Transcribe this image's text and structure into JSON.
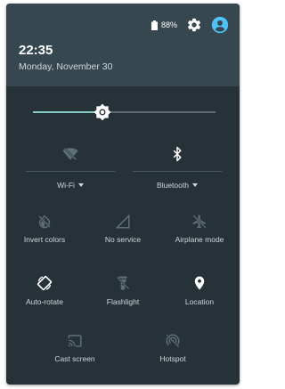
{
  "status": {
    "battery_text": "88%"
  },
  "header": {
    "time": "22:35",
    "date": "Monday, November 30"
  },
  "brightness": {
    "level": 0.38
  },
  "tiles": {
    "wifi": {
      "label": "Wi-Fi"
    },
    "bluetooth": {
      "label": "Bluetooth"
    },
    "invert": {
      "label": "Invert colors"
    },
    "service": {
      "label": "No service"
    },
    "airplane": {
      "label": "Airplane mode"
    },
    "autorotate": {
      "label": "Auto-rotate"
    },
    "flashlight": {
      "label": "Flashlight"
    },
    "location": {
      "label": "Location"
    },
    "cast": {
      "label": "Cast screen"
    },
    "hotspot": {
      "label": "Hotspot"
    }
  },
  "colors": {
    "panel": "#263238",
    "header": "#37474f",
    "accent": "#80cbc4",
    "account": "#4fc3f7",
    "icon_active": "#ffffff",
    "icon_inactive": "#5f6f77"
  },
  "icons": [
    "battery-icon",
    "settings-icon",
    "account-icon",
    "wifi-off-icon",
    "bluetooth-icon",
    "invert-colors-icon",
    "no-service-icon",
    "airplane-icon",
    "auto-rotate-icon",
    "flashlight-icon",
    "location-icon",
    "cast-icon",
    "hotspot-icon",
    "brightness-icon"
  ]
}
